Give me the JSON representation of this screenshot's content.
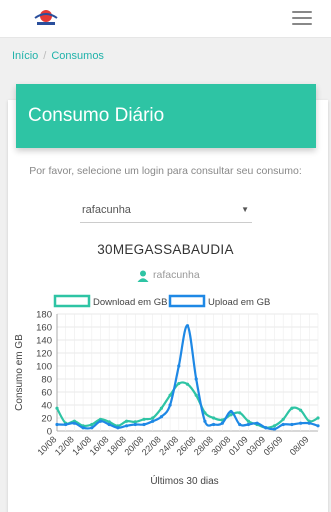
{
  "brand": {
    "logo_text": "PLANETA"
  },
  "breadcrumb": {
    "items": [
      "Início",
      "Consumos"
    ],
    "separator": "/"
  },
  "card": {
    "title": "Consumo Diário",
    "prompt": "Por favor, selecione um login para consultar seu consumo:",
    "select_value": "rafacunha",
    "select_arrow": "▼",
    "plan_name": "30MEGASSABAUDIA",
    "user": "rafacunha"
  },
  "colors": {
    "accent": "#2ec4a4",
    "link": "#20b2aa",
    "download": "#2ec4a4",
    "upload": "#1e88e5"
  },
  "chart_data": {
    "type": "line",
    "xlabel": "Últimos 30 dias",
    "ylabel": "Consumo em GB",
    "ylim": [
      0,
      180
    ],
    "yticks": [
      0,
      20,
      40,
      60,
      80,
      100,
      120,
      140,
      160,
      180
    ],
    "legend_position": "top",
    "grid": true,
    "x": [
      "10/08",
      "11/08",
      "12/08",
      "13/08",
      "14/08",
      "15/08",
      "16/08",
      "17/08",
      "18/08",
      "19/08",
      "20/08",
      "21/08",
      "22/08",
      "23/08",
      "24/08",
      "25/08",
      "26/08",
      "27/08",
      "28/08",
      "29/08",
      "30/08",
      "31/08",
      "01/09",
      "02/09",
      "03/09",
      "04/09",
      "05/09",
      "06/09",
      "07/09",
      "08/09",
      "09/09"
    ],
    "xtick_labels": [
      "10/08",
      "12/08",
      "14/08",
      "16/08",
      "18/08",
      "20/08",
      "22/08",
      "24/08",
      "26/08",
      "28/08",
      "30/08",
      "01/09",
      "03/09",
      "05/09",
      "08/09"
    ],
    "series": [
      {
        "name": "Download em GB",
        "values": [
          35,
          12,
          15,
          8,
          10,
          18,
          14,
          8,
          15,
          14,
          18,
          20,
          35,
          55,
          73,
          72,
          55,
          28,
          20,
          17,
          25,
          28,
          15,
          10,
          5,
          8,
          18,
          35,
          32,
          15,
          20
        ]
      },
      {
        "name": "Upload em GB",
        "values": [
          10,
          10,
          12,
          5,
          5,
          15,
          10,
          5,
          8,
          10,
          10,
          15,
          22,
          40,
          100,
          162,
          80,
          15,
          10,
          12,
          30,
          10,
          10,
          12,
          5,
          3,
          10,
          10,
          12,
          12,
          8
        ]
      }
    ]
  }
}
